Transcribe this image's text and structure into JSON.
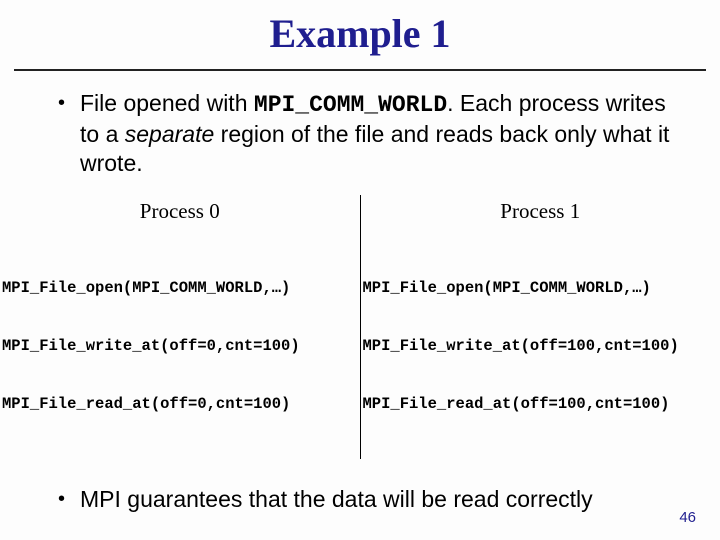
{
  "title": "Example 1",
  "bullet1": {
    "pre": "File opened with ",
    "code": "MPI_COMM_WORLD",
    "mid": ". Each process writes to a ",
    "italic": "separate",
    "post": " region of the file and reads back only what it wrote."
  },
  "proc": {
    "left": {
      "header": "Process 0",
      "lines": [
        "MPI_File_open(MPI_COMM_WORLD,…)",
        "MPI_File_write_at(off=0,cnt=100)",
        "MPI_File_read_at(off=0,cnt=100)"
      ]
    },
    "right": {
      "header": "Process 1",
      "lines": [
        "MPI_File_open(MPI_COMM_WORLD,…)",
        "MPI_File_write_at(off=100,cnt=100)",
        "MPI_File_read_at(off=100,cnt=100)"
      ]
    }
  },
  "bullet2": "MPI guarantees that the data will be read correctly",
  "pagenum": "46"
}
